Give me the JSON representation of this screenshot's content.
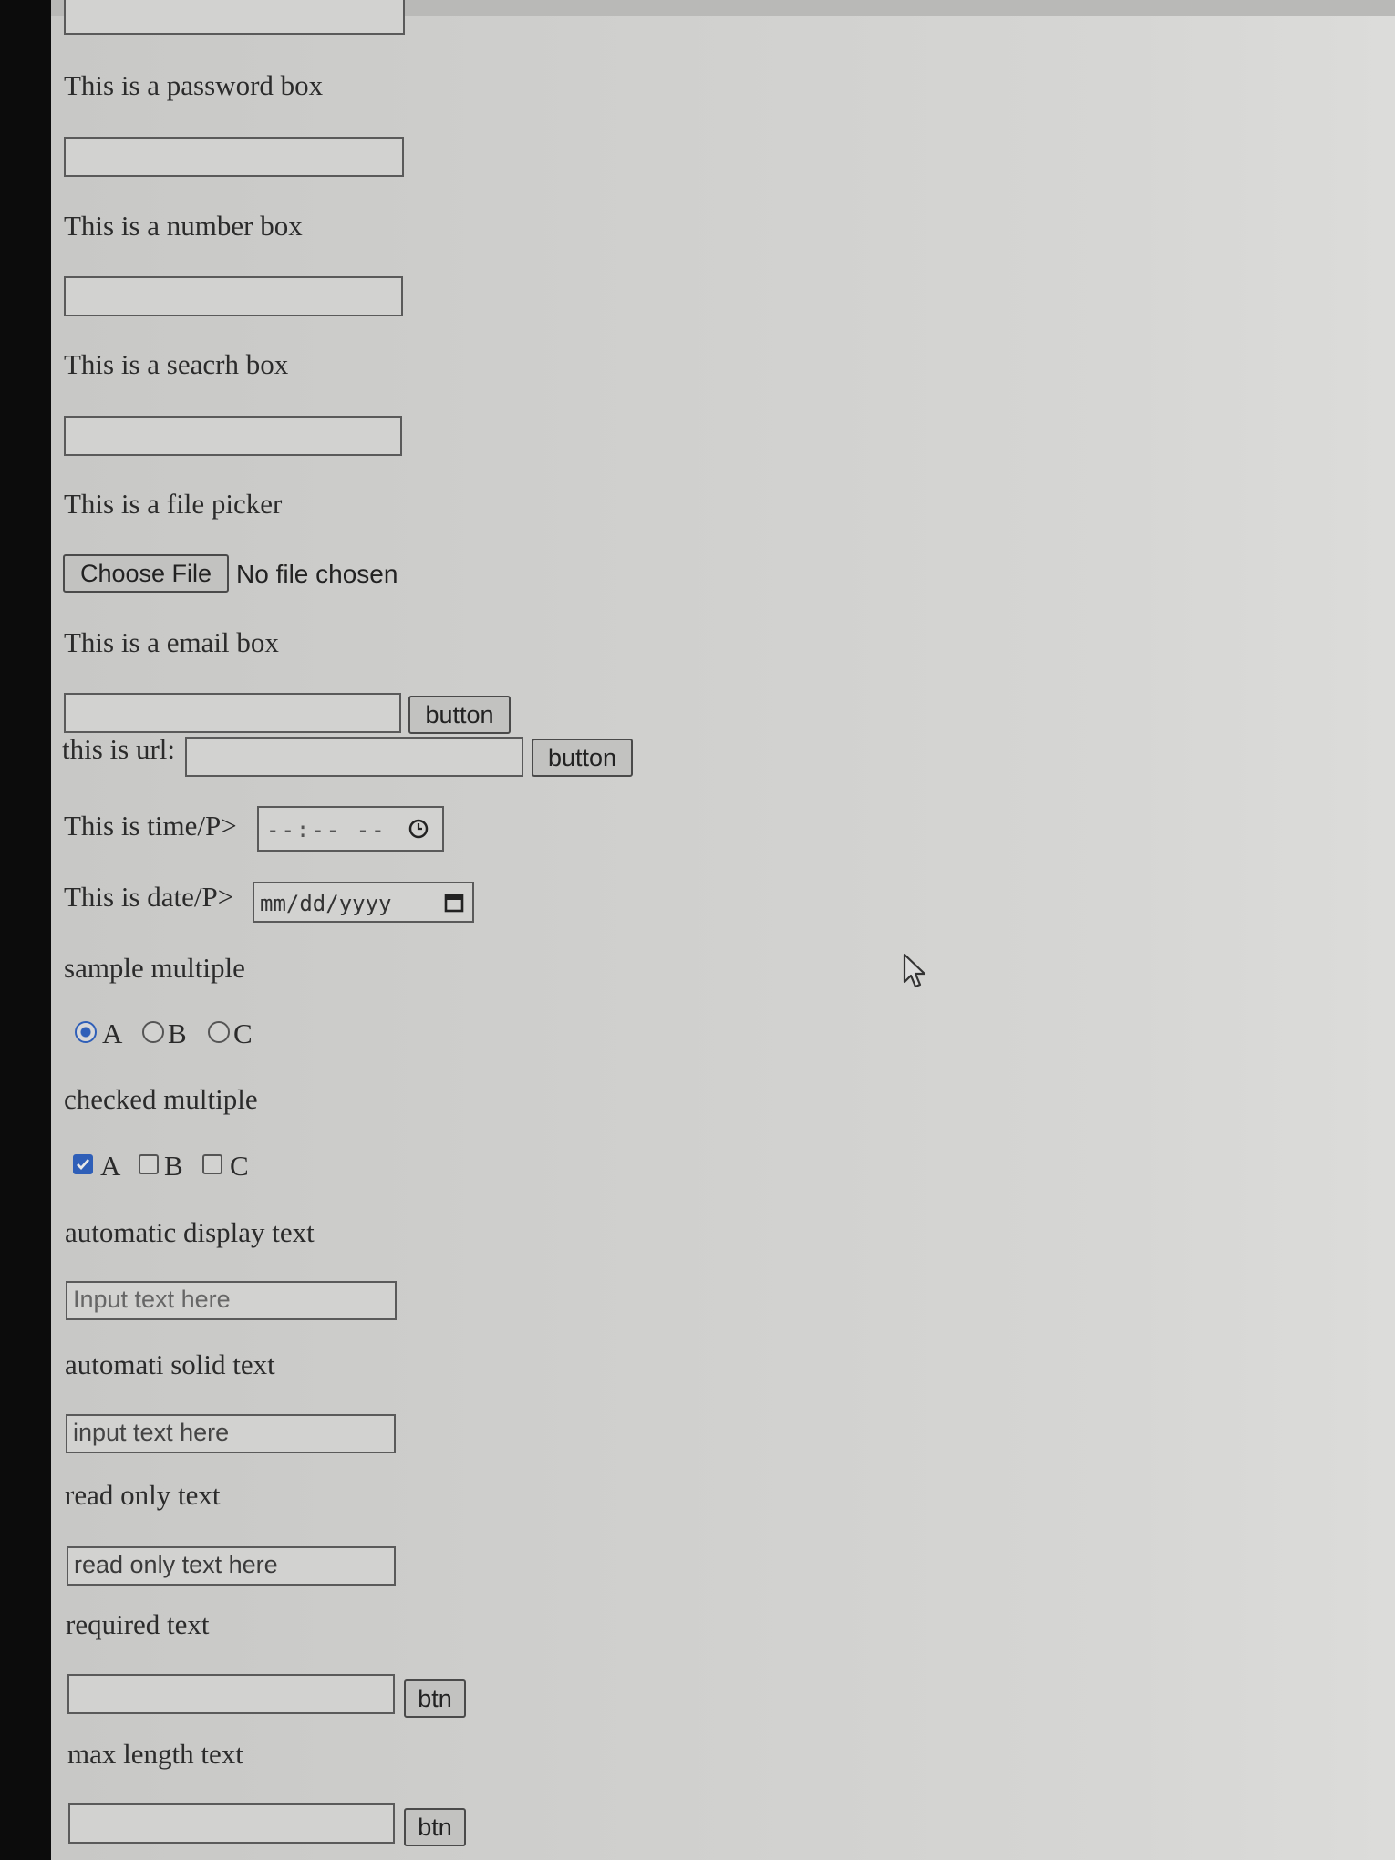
{
  "password": {
    "label": "This is a password box"
  },
  "number": {
    "label": "This is a number box"
  },
  "search": {
    "label": "This is a seacrh box"
  },
  "file": {
    "label": "This is a file picker",
    "button_label": "Choose File",
    "status": "No file chosen"
  },
  "email": {
    "label": "This is a email box",
    "button_label": "button"
  },
  "url": {
    "label": "this is url:",
    "button_label": "button"
  },
  "time": {
    "label": "This is time/P>",
    "placeholder": "--:-- --",
    "icon": "clock-icon"
  },
  "date": {
    "label": "This is date/P>",
    "placeholder": "mm/dd/yyyy",
    "icon": "calendar-icon"
  },
  "radio_group": {
    "label": "sample multiple",
    "options": [
      {
        "label": "A",
        "checked": true
      },
      {
        "label": "B",
        "checked": false
      },
      {
        "label": "C",
        "checked": false
      }
    ]
  },
  "checkbox_group": {
    "label": "checked multiple",
    "options": [
      {
        "label": "A",
        "checked": true
      },
      {
        "label": "B",
        "checked": false
      },
      {
        "label": "C",
        "checked": false
      }
    ]
  },
  "auto_display": {
    "label": "automatic display text",
    "placeholder": "Input text here"
  },
  "auto_solid": {
    "label": "automati solid text",
    "value": "input text here"
  },
  "read_only": {
    "label": "read only text",
    "value": "read only text here"
  },
  "required": {
    "label": "required text",
    "button_label": "btn"
  },
  "max_length": {
    "label": "max length text",
    "button_label": "btn"
  },
  "colors": {
    "accent": "#2f5fb8"
  }
}
